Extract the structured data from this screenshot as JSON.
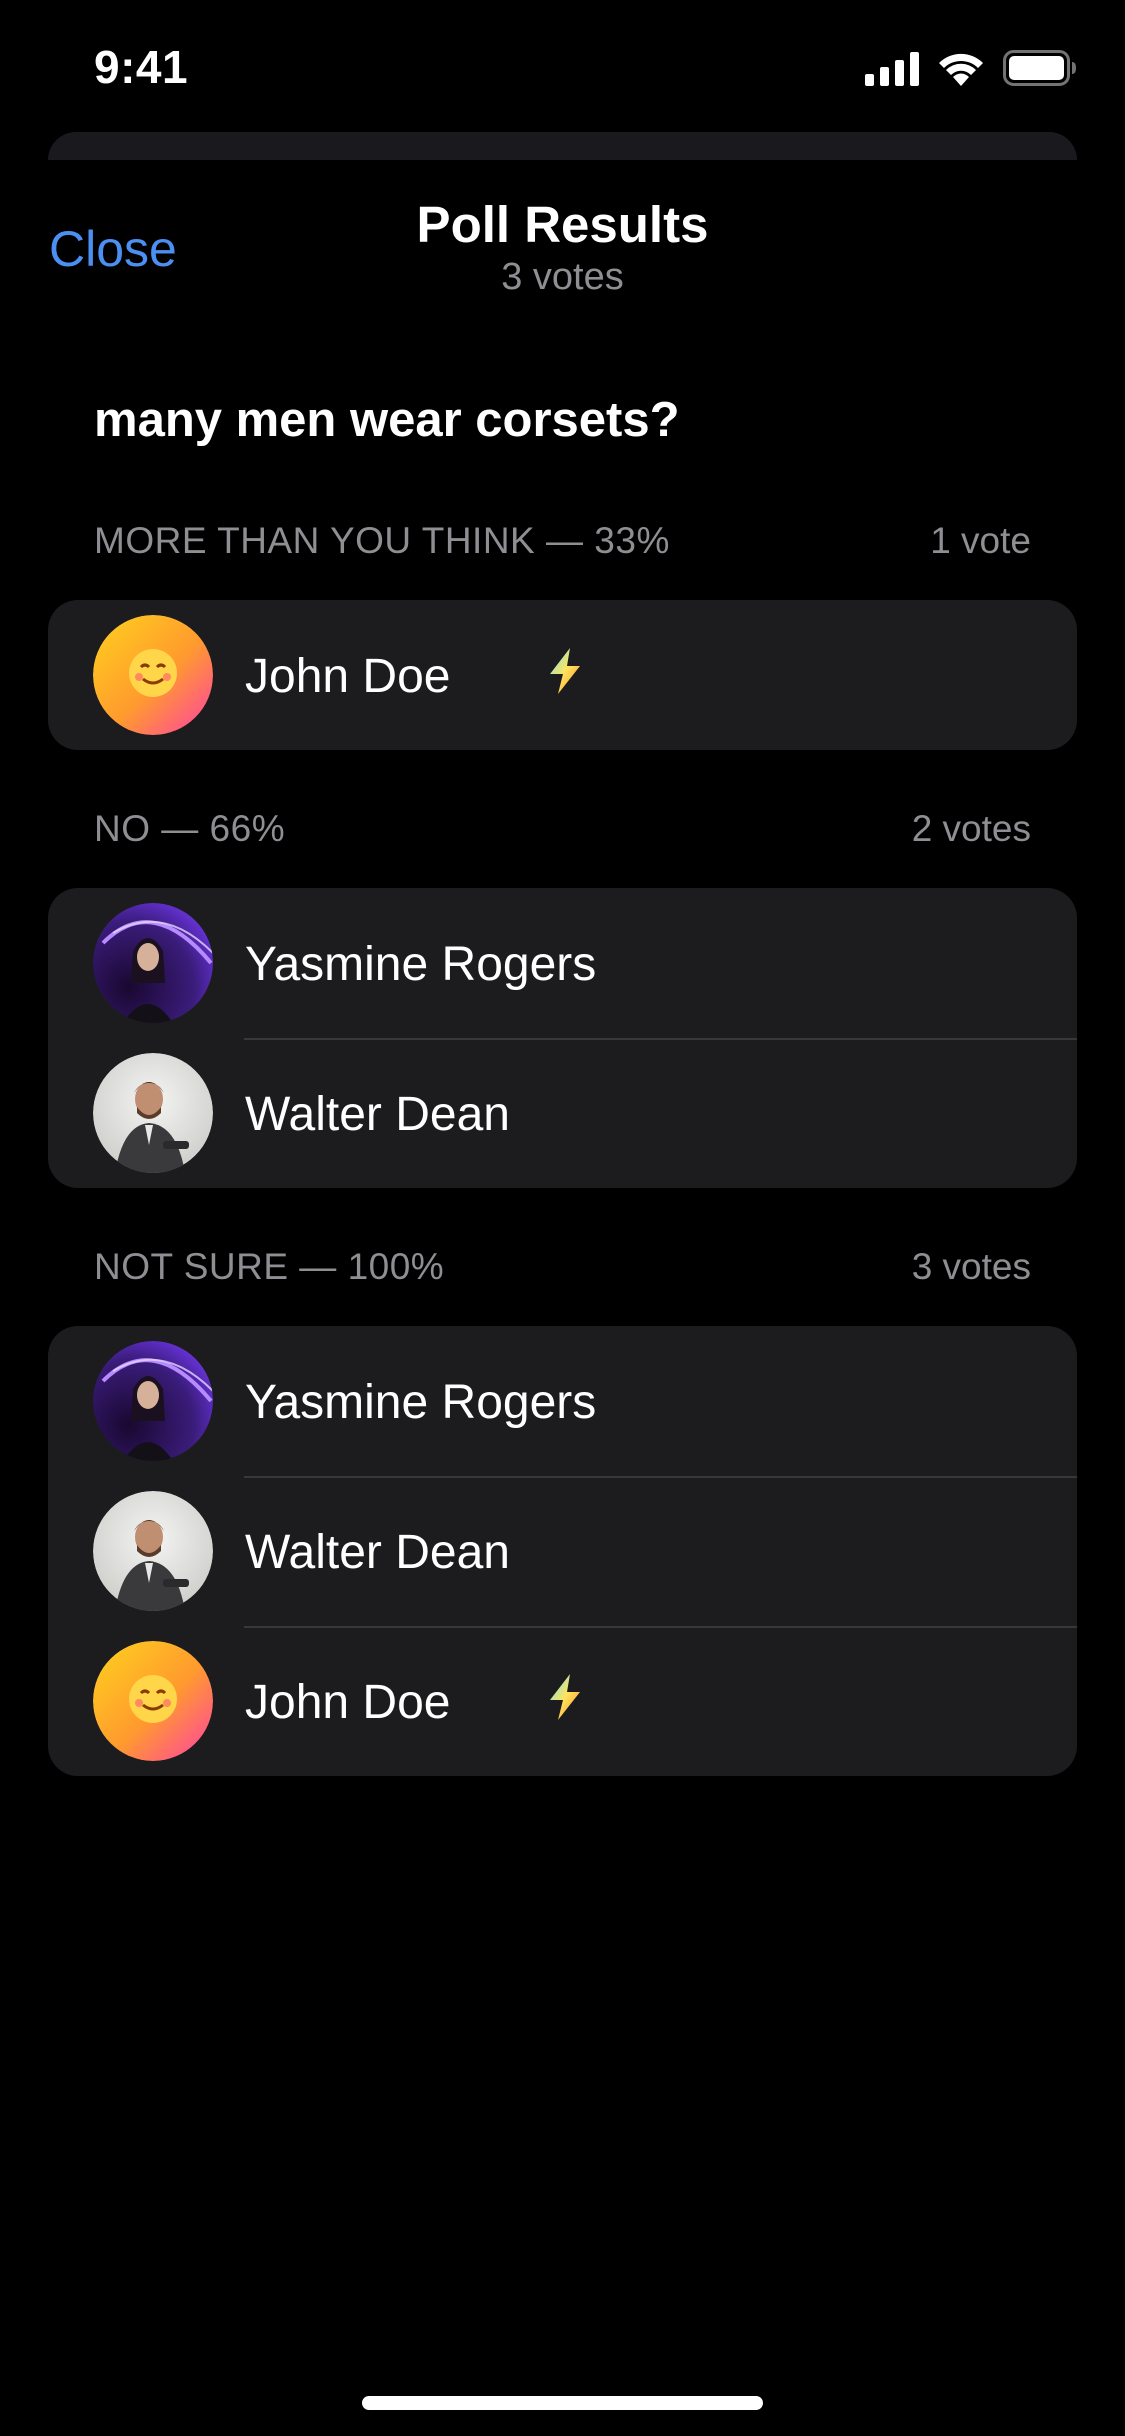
{
  "status_bar": {
    "time": "9:41",
    "icons": [
      "cellular-signal-icon",
      "wifi-icon",
      "battery-icon"
    ]
  },
  "nav": {
    "close_label": "Close",
    "title": "Poll Results",
    "subtitle": "3 votes"
  },
  "poll": {
    "question": "many men wear corsets?",
    "sections": [
      {
        "option": "MORE THAN YOU THINK — 33%",
        "count": "1 vote",
        "voters": [
          {
            "name": "John Doe",
            "avatar": "smiling-face-avatar",
            "badge": "lightning-badge-icon"
          }
        ]
      },
      {
        "option": "NO — 66%",
        "count": "2 votes",
        "voters": [
          {
            "name": "Yasmine Rogers",
            "avatar": "woman-neon-photo-avatar"
          },
          {
            "name": "Walter Dean",
            "avatar": "man-suit-photo-avatar"
          }
        ]
      },
      {
        "option": "NOT SURE — 100%",
        "count": "3 votes",
        "voters": [
          {
            "name": "Yasmine Rogers",
            "avatar": "woman-neon-photo-avatar"
          },
          {
            "name": "Walter Dean",
            "avatar": "man-suit-photo-avatar"
          },
          {
            "name": "John Doe",
            "avatar": "smiling-face-avatar",
            "badge": "lightning-badge-icon"
          }
        ]
      }
    ]
  },
  "colors": {
    "background": "#000000",
    "card": "#1c1c1e",
    "accent": "#4b8ff2",
    "secondary_text": "#8e8e93",
    "separator": "#38383a"
  }
}
